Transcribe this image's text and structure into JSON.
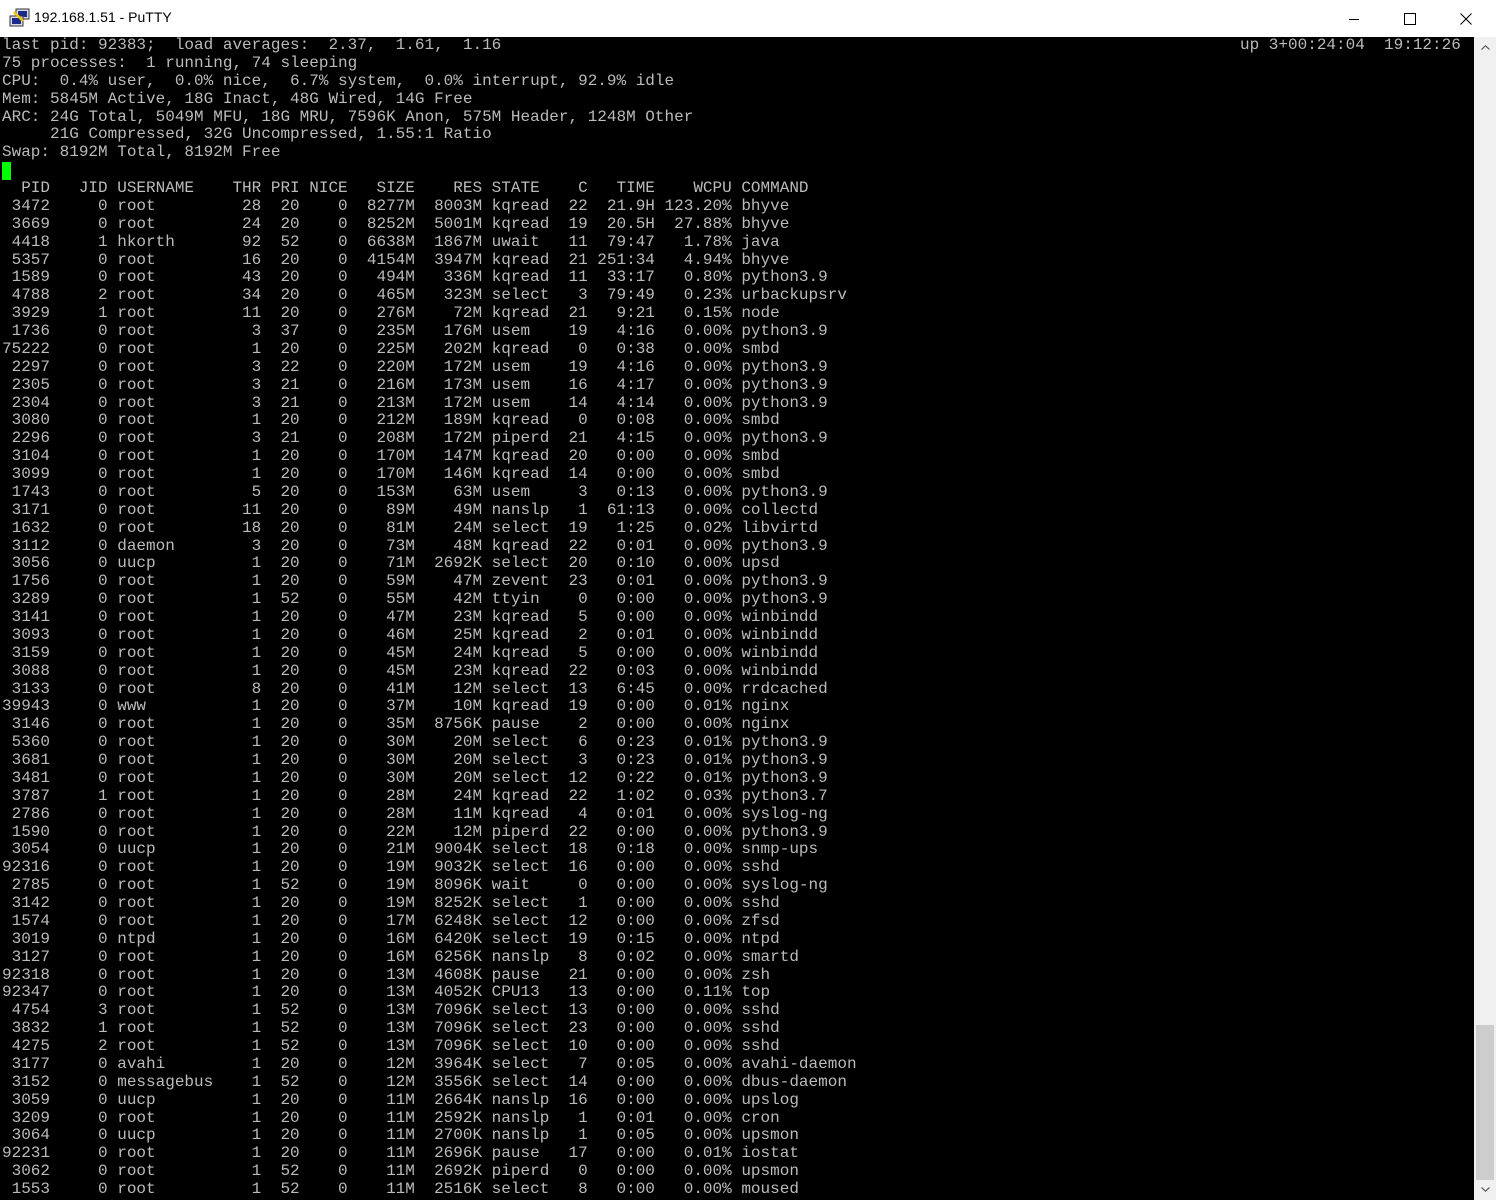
{
  "window": {
    "title": "192.168.1.51 - PuTTY",
    "icon": "putty-icon",
    "buttons": {
      "minimize_icon": "minimize-icon",
      "maximize_icon": "maximize-icon",
      "close_icon": "close-icon"
    }
  },
  "colors": {
    "terminal_bg": "#000000",
    "terminal_fg": "#bbbbbb",
    "cursor": "#00ff00",
    "titlebar_bg": "#ffffff"
  },
  "terminal": {
    "uptime": "up 3+00:24:04  19:12:26",
    "summary": [
      "last pid: 92383;  load averages:  2.37,  1.61,  1.16",
      "75 processes:  1 running, 74 sleeping",
      "CPU:  0.4% user,  0.0% nice,  6.7% system,  0.0% interrupt, 92.9% idle",
      "Mem: 5845M Active, 18G Inact, 48G Wired, 14G Free",
      "ARC: 24G Total, 5049M MFU, 18G MRU, 7596K Anon, 575M Header, 1248M Other",
      "     21G Compressed, 32G Uncompressed, 1.55:1 Ratio",
      "Swap: 8192M Total, 8192M Free"
    ],
    "table": {
      "columns": [
        "PID",
        "JID",
        "USERNAME",
        "THR",
        "PRI",
        "NICE",
        "SIZE",
        "RES",
        "STATE",
        "C",
        "TIME",
        "WCPU",
        "COMMAND"
      ],
      "rows": [
        [
          "3472",
          "0",
          "root",
          "28",
          "20",
          "0",
          "8277M",
          "8003M",
          "kqread",
          "22",
          "21.9H",
          "123.20%",
          "bhyve"
        ],
        [
          "3669",
          "0",
          "root",
          "24",
          "20",
          "0",
          "8252M",
          "5001M",
          "kqread",
          "19",
          "20.5H",
          "27.88%",
          "bhyve"
        ],
        [
          "4418",
          "1",
          "hkorth",
          "92",
          "52",
          "0",
          "6638M",
          "1867M",
          "uwait",
          "11",
          "79:47",
          "1.78%",
          "java"
        ],
        [
          "5357",
          "0",
          "root",
          "16",
          "20",
          "0",
          "4154M",
          "3947M",
          "kqread",
          "21",
          "251:34",
          "4.94%",
          "bhyve"
        ],
        [
          "1589",
          "0",
          "root",
          "43",
          "20",
          "0",
          "494M",
          "336M",
          "kqread",
          "11",
          "33:17",
          "0.80%",
          "python3.9"
        ],
        [
          "4788",
          "2",
          "root",
          "34",
          "20",
          "0",
          "465M",
          "323M",
          "select",
          "3",
          "79:49",
          "0.23%",
          "urbackupsrv"
        ],
        [
          "3929",
          "1",
          "root",
          "11",
          "20",
          "0",
          "276M",
          "72M",
          "kqread",
          "21",
          "9:21",
          "0.15%",
          "node"
        ],
        [
          "1736",
          "0",
          "root",
          "3",
          "37",
          "0",
          "235M",
          "176M",
          "usem",
          "19",
          "4:16",
          "0.00%",
          "python3.9"
        ],
        [
          "75222",
          "0",
          "root",
          "1",
          "20",
          "0",
          "225M",
          "202M",
          "kqread",
          "0",
          "0:38",
          "0.00%",
          "smbd"
        ],
        [
          "2297",
          "0",
          "root",
          "3",
          "22",
          "0",
          "220M",
          "172M",
          "usem",
          "19",
          "4:16",
          "0.00%",
          "python3.9"
        ],
        [
          "2305",
          "0",
          "root",
          "3",
          "21",
          "0",
          "216M",
          "173M",
          "usem",
          "16",
          "4:17",
          "0.00%",
          "python3.9"
        ],
        [
          "2304",
          "0",
          "root",
          "3",
          "21",
          "0",
          "213M",
          "172M",
          "usem",
          "14",
          "4:14",
          "0.00%",
          "python3.9"
        ],
        [
          "3080",
          "0",
          "root",
          "1",
          "20",
          "0",
          "212M",
          "189M",
          "kqread",
          "0",
          "0:08",
          "0.00%",
          "smbd"
        ],
        [
          "2296",
          "0",
          "root",
          "3",
          "21",
          "0",
          "208M",
          "172M",
          "piperd",
          "21",
          "4:15",
          "0.00%",
          "python3.9"
        ],
        [
          "3104",
          "0",
          "root",
          "1",
          "20",
          "0",
          "170M",
          "147M",
          "kqread",
          "20",
          "0:00",
          "0.00%",
          "smbd"
        ],
        [
          "3099",
          "0",
          "root",
          "1",
          "20",
          "0",
          "170M",
          "146M",
          "kqread",
          "14",
          "0:00",
          "0.00%",
          "smbd"
        ],
        [
          "1743",
          "0",
          "root",
          "5",
          "20",
          "0",
          "153M",
          "63M",
          "usem",
          "3",
          "0:13",
          "0.00%",
          "python3.9"
        ],
        [
          "3171",
          "0",
          "root",
          "11",
          "20",
          "0",
          "89M",
          "49M",
          "nanslp",
          "1",
          "61:13",
          "0.00%",
          "collectd"
        ],
        [
          "1632",
          "0",
          "root",
          "18",
          "20",
          "0",
          "81M",
          "24M",
          "select",
          "19",
          "1:25",
          "0.02%",
          "libvirtd"
        ],
        [
          "3112",
          "0",
          "daemon",
          "3",
          "20",
          "0",
          "73M",
          "48M",
          "kqread",
          "22",
          "0:01",
          "0.00%",
          "python3.9"
        ],
        [
          "3056",
          "0",
          "uucp",
          "1",
          "20",
          "0",
          "71M",
          "2692K",
          "select",
          "20",
          "0:10",
          "0.00%",
          "upsd"
        ],
        [
          "1756",
          "0",
          "root",
          "1",
          "20",
          "0",
          "59M",
          "47M",
          "zevent",
          "23",
          "0:01",
          "0.00%",
          "python3.9"
        ],
        [
          "3289",
          "0",
          "root",
          "1",
          "52",
          "0",
          "55M",
          "42M",
          "ttyin",
          "0",
          "0:00",
          "0.00%",
          "python3.9"
        ],
        [
          "3141",
          "0",
          "root",
          "1",
          "20",
          "0",
          "47M",
          "23M",
          "kqread",
          "5",
          "0:00",
          "0.00%",
          "winbindd"
        ],
        [
          "3093",
          "0",
          "root",
          "1",
          "20",
          "0",
          "46M",
          "25M",
          "kqread",
          "2",
          "0:01",
          "0.00%",
          "winbindd"
        ],
        [
          "3159",
          "0",
          "root",
          "1",
          "20",
          "0",
          "45M",
          "24M",
          "kqread",
          "5",
          "0:00",
          "0.00%",
          "winbindd"
        ],
        [
          "3088",
          "0",
          "root",
          "1",
          "20",
          "0",
          "45M",
          "23M",
          "kqread",
          "22",
          "0:03",
          "0.00%",
          "winbindd"
        ],
        [
          "3133",
          "0",
          "root",
          "8",
          "20",
          "0",
          "41M",
          "12M",
          "select",
          "13",
          "6:45",
          "0.00%",
          "rrdcached"
        ],
        [
          "39943",
          "0",
          "www",
          "1",
          "20",
          "0",
          "37M",
          "10M",
          "kqread",
          "19",
          "0:00",
          "0.01%",
          "nginx"
        ],
        [
          "3146",
          "0",
          "root",
          "1",
          "20",
          "0",
          "35M",
          "8756K",
          "pause",
          "2",
          "0:00",
          "0.00%",
          "nginx"
        ],
        [
          "5360",
          "0",
          "root",
          "1",
          "20",
          "0",
          "30M",
          "20M",
          "select",
          "6",
          "0:23",
          "0.01%",
          "python3.9"
        ],
        [
          "3681",
          "0",
          "root",
          "1",
          "20",
          "0",
          "30M",
          "20M",
          "select",
          "3",
          "0:23",
          "0.01%",
          "python3.9"
        ],
        [
          "3481",
          "0",
          "root",
          "1",
          "20",
          "0",
          "30M",
          "20M",
          "select",
          "12",
          "0:22",
          "0.01%",
          "python3.9"
        ],
        [
          "3787",
          "1",
          "root",
          "1",
          "20",
          "0",
          "28M",
          "24M",
          "kqread",
          "22",
          "1:02",
          "0.03%",
          "python3.7"
        ],
        [
          "2786",
          "0",
          "root",
          "1",
          "20",
          "0",
          "28M",
          "11M",
          "kqread",
          "4",
          "0:01",
          "0.00%",
          "syslog-ng"
        ],
        [
          "1590",
          "0",
          "root",
          "1",
          "20",
          "0",
          "22M",
          "12M",
          "piperd",
          "22",
          "0:00",
          "0.00%",
          "python3.9"
        ],
        [
          "3054",
          "0",
          "uucp",
          "1",
          "20",
          "0",
          "21M",
          "9004K",
          "select",
          "18",
          "0:18",
          "0.00%",
          "snmp-ups"
        ],
        [
          "92316",
          "0",
          "root",
          "1",
          "20",
          "0",
          "19M",
          "9032K",
          "select",
          "16",
          "0:00",
          "0.00%",
          "sshd"
        ],
        [
          "2785",
          "0",
          "root",
          "1",
          "52",
          "0",
          "19M",
          "8096K",
          "wait",
          "0",
          "0:00",
          "0.00%",
          "syslog-ng"
        ],
        [
          "3142",
          "0",
          "root",
          "1",
          "20",
          "0",
          "19M",
          "8252K",
          "select",
          "1",
          "0:00",
          "0.00%",
          "sshd"
        ],
        [
          "1574",
          "0",
          "root",
          "1",
          "20",
          "0",
          "17M",
          "6248K",
          "select",
          "12",
          "0:00",
          "0.00%",
          "zfsd"
        ],
        [
          "3019",
          "0",
          "ntpd",
          "1",
          "20",
          "0",
          "16M",
          "6420K",
          "select",
          "19",
          "0:15",
          "0.00%",
          "ntpd"
        ],
        [
          "3127",
          "0",
          "root",
          "1",
          "20",
          "0",
          "16M",
          "6256K",
          "nanslp",
          "8",
          "0:02",
          "0.00%",
          "smartd"
        ],
        [
          "92318",
          "0",
          "root",
          "1",
          "20",
          "0",
          "13M",
          "4608K",
          "pause",
          "21",
          "0:00",
          "0.00%",
          "zsh"
        ],
        [
          "92347",
          "0",
          "root",
          "1",
          "20",
          "0",
          "13M",
          "4052K",
          "CPU13",
          "13",
          "0:00",
          "0.11%",
          "top"
        ],
        [
          "4754",
          "3",
          "root",
          "1",
          "52",
          "0",
          "13M",
          "7096K",
          "select",
          "13",
          "0:00",
          "0.00%",
          "sshd"
        ],
        [
          "3832",
          "1",
          "root",
          "1",
          "52",
          "0",
          "13M",
          "7096K",
          "select",
          "23",
          "0:00",
          "0.00%",
          "sshd"
        ],
        [
          "4275",
          "2",
          "root",
          "1",
          "52",
          "0",
          "13M",
          "7096K",
          "select",
          "10",
          "0:00",
          "0.00%",
          "sshd"
        ],
        [
          "3177",
          "0",
          "avahi",
          "1",
          "20",
          "0",
          "12M",
          "3964K",
          "select",
          "7",
          "0:05",
          "0.00%",
          "avahi-daemon"
        ],
        [
          "3152",
          "0",
          "messagebus",
          "1",
          "52",
          "0",
          "12M",
          "3556K",
          "select",
          "14",
          "0:00",
          "0.00%",
          "dbus-daemon"
        ],
        [
          "3059",
          "0",
          "uucp",
          "1",
          "20",
          "0",
          "11M",
          "2664K",
          "nanslp",
          "16",
          "0:00",
          "0.00%",
          "upslog"
        ],
        [
          "3209",
          "0",
          "root",
          "1",
          "20",
          "0",
          "11M",
          "2592K",
          "nanslp",
          "1",
          "0:01",
          "0.00%",
          "cron"
        ],
        [
          "3064",
          "0",
          "uucp",
          "1",
          "20",
          "0",
          "11M",
          "2700K",
          "nanslp",
          "1",
          "0:05",
          "0.00%",
          "upsmon"
        ],
        [
          "92231",
          "0",
          "root",
          "1",
          "20",
          "0",
          "11M",
          "2696K",
          "pause",
          "17",
          "0:00",
          "0.01%",
          "iostat"
        ],
        [
          "3062",
          "0",
          "root",
          "1",
          "52",
          "0",
          "11M",
          "2692K",
          "piperd",
          "0",
          "0:00",
          "0.00%",
          "upsmon"
        ],
        [
          "1553",
          "0",
          "root",
          "1",
          "52",
          "0",
          "11M",
          "2516K",
          "select",
          "8",
          "0:00",
          "0.00%",
          "moused"
        ]
      ]
    }
  },
  "scrollbar": {
    "up_icon": "scroll-up-arrow-icon",
    "down_icon": "scroll-down-arrow-icon"
  }
}
